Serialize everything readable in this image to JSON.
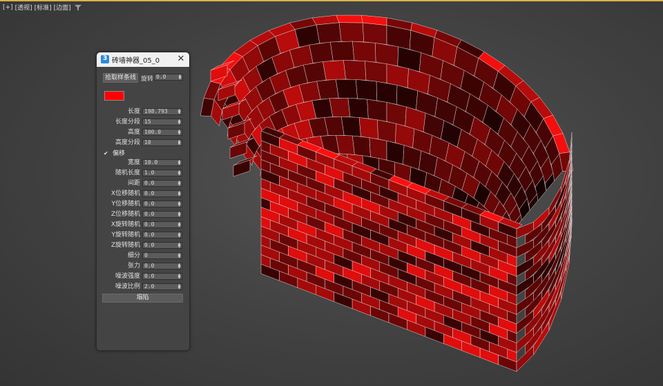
{
  "viewport": {
    "labels": [
      "[+]",
      "[透视]",
      "[标准]",
      "[边面]"
    ]
  },
  "panel": {
    "title": "砖墙神器_05_0",
    "pick_spline_label": "拾取样条线",
    "rotate_label": "旋转",
    "rotate_value": "0.0",
    "color": "#ff0000",
    "offset": {
      "label": "偏移",
      "checked": true,
      "check_glyph": "✔"
    },
    "params": [
      {
        "label": "长度",
        "value": "198.793"
      },
      {
        "label": "长度分段",
        "value": "15"
      },
      {
        "label": "高度",
        "value": "100.0"
      },
      {
        "label": "高度分段",
        "value": "10"
      }
    ],
    "params2": [
      {
        "label": "宽度",
        "value": "10.0"
      },
      {
        "label": "随机长度",
        "value": "1.0"
      },
      {
        "label": "间距",
        "value": "0.0"
      },
      {
        "label": "X位移随机",
        "value": "0.0"
      },
      {
        "label": "Y位移随机",
        "value": "0.0"
      },
      {
        "label": "Z位移随机",
        "value": "0.0"
      },
      {
        "label": "X旋转随机",
        "value": "0.0"
      },
      {
        "label": "Y旋转随机",
        "value": "0.0"
      },
      {
        "label": "Z旋转随机",
        "value": "0.0"
      },
      {
        "label": "细分",
        "value": "0"
      },
      {
        "label": "张力",
        "value": "0.0"
      },
      {
        "label": "噪波强度",
        "value": "0.0"
      },
      {
        "label": "噪波比例",
        "value": "2.0"
      }
    ],
    "seam_label": "塌陷"
  },
  "brick_colors": {
    "bright": "#e00d0d",
    "mid": "#a50a0a",
    "dark": "#6b0606",
    "darker": "#3a0303",
    "black": "#140101"
  }
}
